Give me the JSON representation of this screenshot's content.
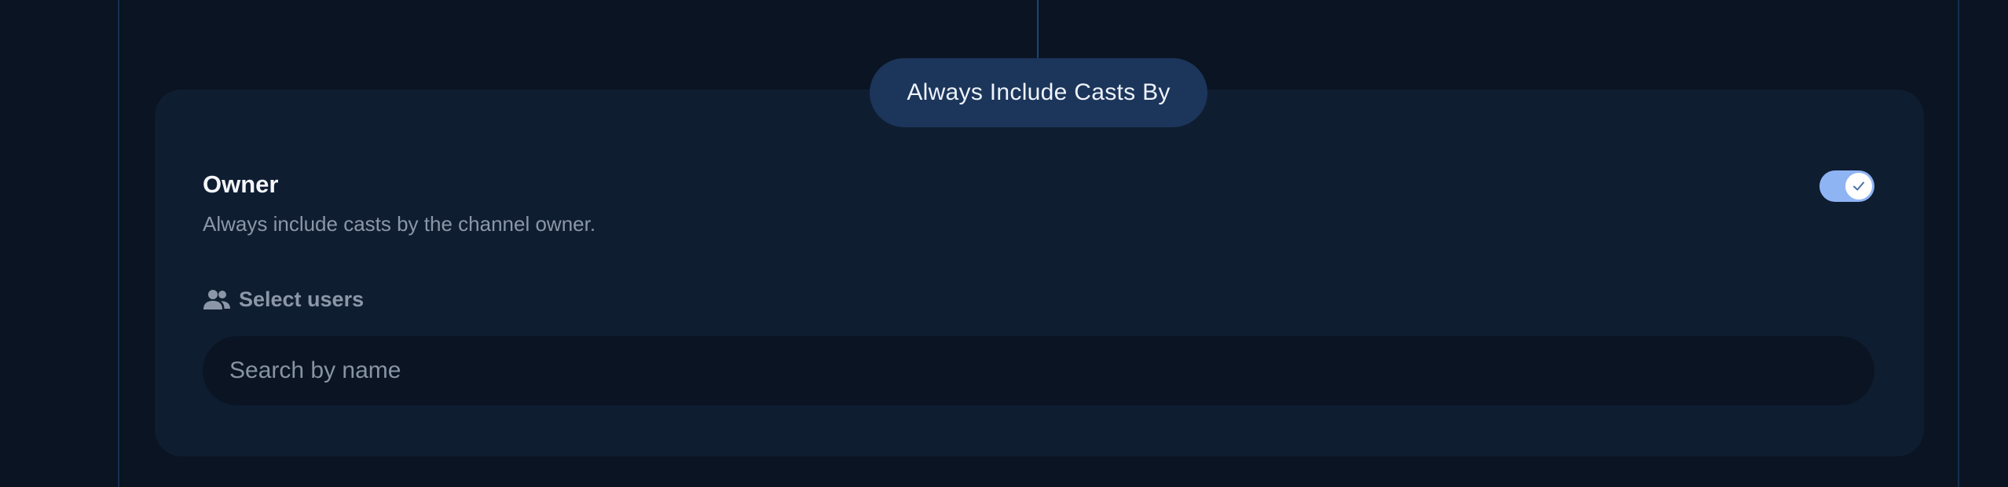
{
  "section": {
    "pill_label": "Always Include Casts By"
  },
  "owner": {
    "title": "Owner",
    "description": "Always include casts by the channel owner.",
    "toggle_on": true
  },
  "users": {
    "label": "Select users",
    "icon": "users-icon",
    "search_placeholder": "Search by name",
    "search_value": ""
  },
  "colors": {
    "background": "#0a1422",
    "card": "#0f1d31",
    "pill": "#1c355a",
    "toggle": "#8fb4f4"
  }
}
